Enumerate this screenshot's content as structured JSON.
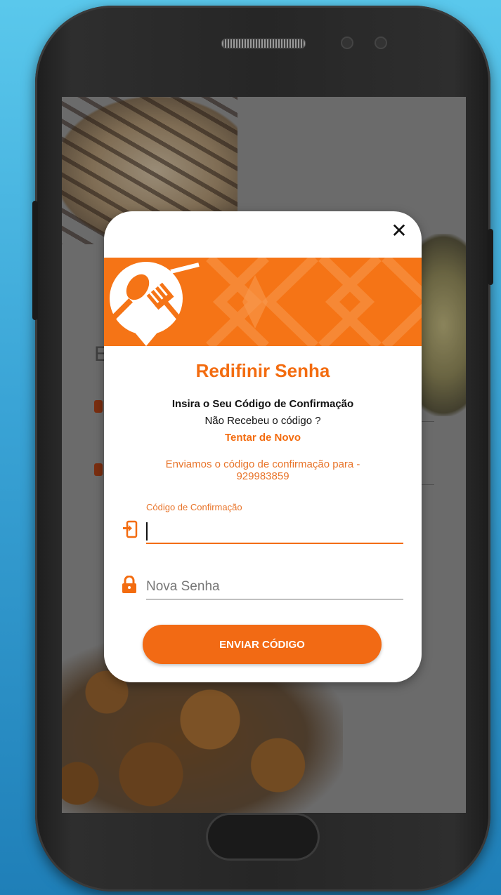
{
  "dialog": {
    "close_icon": "close-icon",
    "title": "Redifinir Senha",
    "instruction": "Insira o Seu Código de Confirmação",
    "not_received": "Não Recebeu o código ?",
    "retry_link": "Tentar de Novo",
    "sent_to_line1": "Enviamos o código de confirmação para -",
    "phone_number": "929983859",
    "code_field": {
      "label": "Código de Confirmação",
      "value": "",
      "icon": "phone-login-icon"
    },
    "password_field": {
      "placeholder": "Nova Senha",
      "value": "",
      "icon": "lock-icon"
    },
    "submit_label": "ENVIAR CÓDIGO"
  },
  "background_screen": {
    "partial_letter": "E"
  },
  "colors": {
    "accent": "#f36c10",
    "banner": "#f57416",
    "background_top": "#5ac8ec",
    "background_bottom": "#1f7fb8"
  }
}
